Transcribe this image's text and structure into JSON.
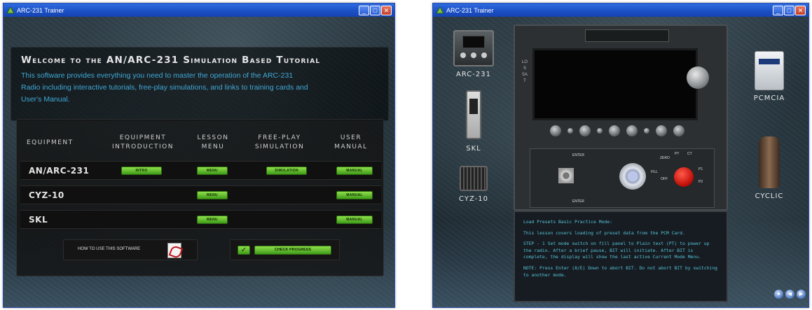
{
  "left_window": {
    "title": "ARC-231 Trainer",
    "welcome_title": "Welcome to the AN/ARC-231 Simulation Based Tutorial",
    "welcome_text": "This software provides everything you need to master the operation of the ARC-231 Radio including interactive tutorials, free-play simulations, and links to training cards and User's Manual.",
    "headers": {
      "equipment": "EQUIPMENT",
      "intro": "EQUIPMENT\nINTRODUCTION",
      "lesson": "LESSON\nMENU",
      "freeplay": "FREE-PLAY\nSIMULATION",
      "manual": "USER\nMANUAL"
    },
    "rows": [
      {
        "label": "AN/ARC-231",
        "intro": "INTRO",
        "menu": "MENU",
        "simulation": "SIMULATION",
        "manual": "MANUAL"
      },
      {
        "label": "CYZ-10",
        "menu": "MENU",
        "manual": "MANUAL"
      },
      {
        "label": "SKL",
        "menu": "MENU",
        "manual": "MANUAL"
      }
    ],
    "howto_label": "HOW TO USE THIS SOFTWARE",
    "progress_label": "CHECK PROGRESS"
  },
  "right_window": {
    "title": "ARC-231 Trainer",
    "left_devices": [
      "ARC-231",
      "SKL",
      "CYZ-10"
    ],
    "right_devices": [
      "PCMCIA",
      "CYCLIC"
    ],
    "radio": {
      "side_label": "LOS SAT",
      "enter_top": "ENTER",
      "enter_bottom": "ENTER",
      "fill_label": "FILL",
      "switch_labels": [
        "ZERO",
        "PT",
        "CT",
        "OFF",
        "P1",
        "P2"
      ]
    },
    "info": {
      "title": "Load Presets Basic Practice Mode:",
      "para1": "This lesson covers loading of preset data from the PCM Card.",
      "para2": "STEP - 1 Set mode switch on fill panel to Plain text (PT) to power up the radio. After a brief pause, BIT will initiate. After BIT is complete, the display will show the last active Current Mode Menu.",
      "para3": "NOTE: Press Enter (8/E) Down to abort BIT. Do not abort BIT by switching to another mode."
    }
  },
  "colors": {
    "titlebar": "#1a4fc4",
    "accent_green": "#6cc232",
    "text_blue": "#3fa9d6",
    "info_text": "#57c3d8"
  }
}
